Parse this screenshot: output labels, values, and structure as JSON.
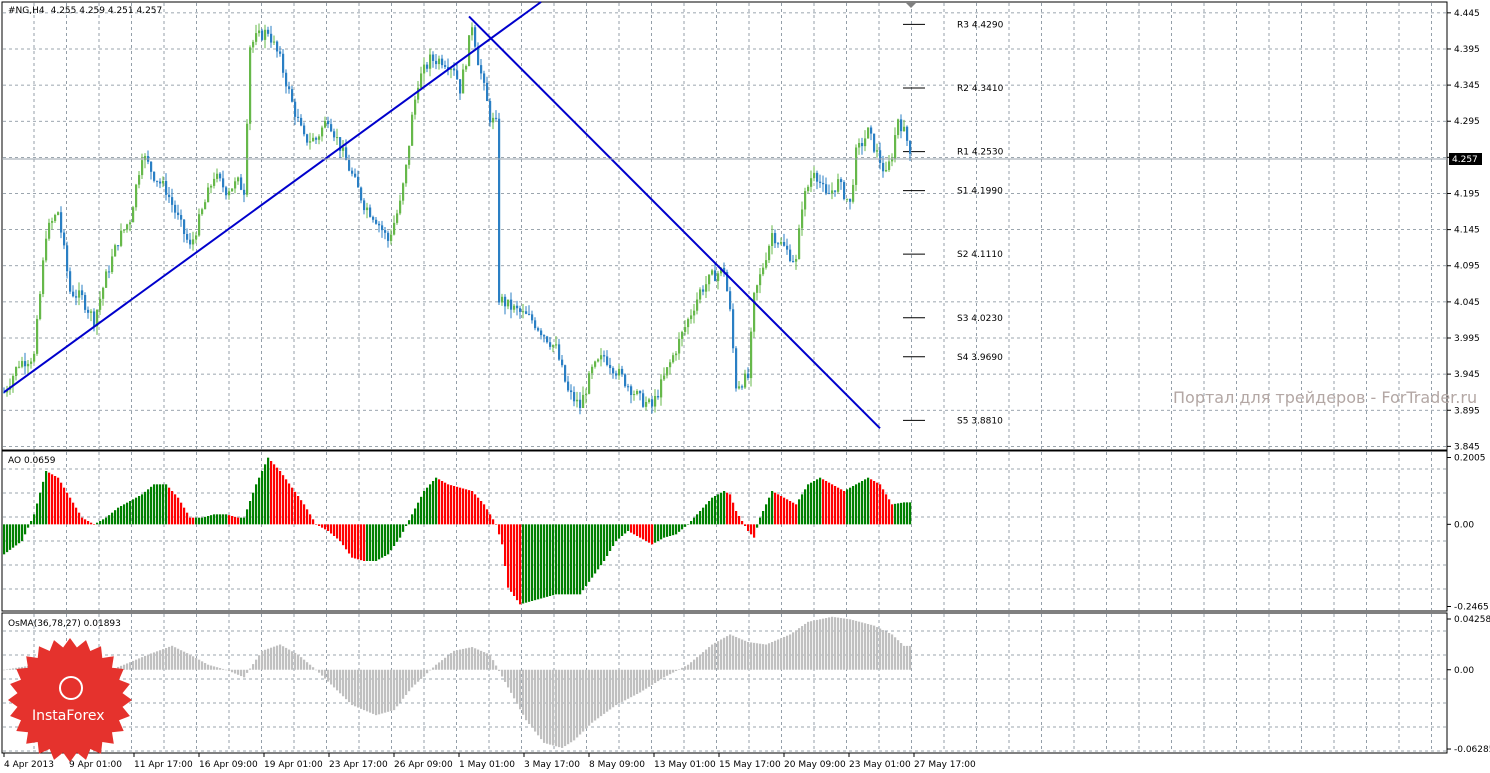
{
  "chart_data": [
    {
      "type": "candlestick",
      "title": "#NG,H4",
      "ohlc_header": "4.255 4.259 4.251 4.257",
      "current_price": "4.257",
      "y_ticks": [
        "4.445",
        "4.395",
        "4.345",
        "4.295",
        "4.245",
        "4.195",
        "4.145",
        "4.095",
        "4.045",
        "3.995",
        "3.945",
        "3.895",
        "3.845"
      ],
      "ylim": [
        3.84,
        4.46
      ],
      "x_ticks": [
        "4 Apr 2013",
        "9 Apr 01:00",
        "11 Apr 17:00",
        "16 Apr 09:00",
        "19 Apr 01:00",
        "23 Apr 17:00",
        "26 Apr 09:00",
        "1 May 01:00",
        "3 May 17:00",
        "8 May 09:00",
        "13 May 01:00",
        "15 May 17:00",
        "20 May 09:00",
        "23 May 01:00",
        "27 May 17:00"
      ],
      "pivot_levels": [
        {
          "label": "R3",
          "value": "4.4290"
        },
        {
          "label": "R2",
          "value": "4.3410"
        },
        {
          "label": "R1",
          "value": "4.2530"
        },
        {
          "label": "S1",
          "value": "4.1990"
        },
        {
          "label": "S2",
          "value": "4.1110"
        },
        {
          "label": "S3",
          "value": "4.0230"
        },
        {
          "label": "S4",
          "value": "3.9690"
        },
        {
          "label": "S5",
          "value": "3.8810"
        }
      ],
      "trendlines": [
        {
          "name": "support-trendline",
          "from": [
            0,
            3.92
          ],
          "to": [
            179,
            4.46
          ]
        },
        {
          "name": "resistance-trendline",
          "from": [
            155,
            4.44
          ],
          "to": [
            292,
            3.87
          ]
        }
      ],
      "close_path": [
        [
          0,
          3.92
        ],
        [
          5,
          3.96
        ],
        [
          10,
          3.97
        ],
        [
          14,
          4.14
        ],
        [
          18,
          4.17
        ],
        [
          22,
          4.06
        ],
        [
          26,
          4.05
        ],
        [
          30,
          4.02
        ],
        [
          34,
          4.08
        ],
        [
          38,
          4.13
        ],
        [
          42,
          4.16
        ],
        [
          46,
          4.25
        ],
        [
          50,
          4.22
        ],
        [
          54,
          4.2
        ],
        [
          58,
          4.16
        ],
        [
          62,
          4.12
        ],
        [
          66,
          4.17
        ],
        [
          70,
          4.22
        ],
        [
          74,
          4.2
        ],
        [
          78,
          4.21
        ],
        [
          80,
          4.2
        ],
        [
          82,
          4.4
        ],
        [
          84,
          4.41
        ],
        [
          88,
          4.42
        ],
        [
          92,
          4.38
        ],
        [
          96,
          4.32
        ],
        [
          100,
          4.27
        ],
        [
          104,
          4.27
        ],
        [
          108,
          4.3
        ],
        [
          112,
          4.26
        ],
        [
          116,
          4.22
        ],
        [
          120,
          4.18
        ],
        [
          124,
          4.16
        ],
        [
          128,
          4.13
        ],
        [
          132,
          4.18
        ],
        [
          134,
          4.23
        ],
        [
          136,
          4.3
        ],
        [
          138,
          4.35
        ],
        [
          142,
          4.38
        ],
        [
          146,
          4.38
        ],
        [
          150,
          4.37
        ],
        [
          152,
          4.34
        ],
        [
          154,
          4.38
        ],
        [
          156,
          4.43
        ],
        [
          158,
          4.38
        ],
        [
          160,
          4.34
        ],
        [
          162,
          4.3
        ],
        [
          164,
          4.29
        ],
        [
          165,
          4.05
        ],
        [
          168,
          4.04
        ],
        [
          172,
          4.03
        ],
        [
          176,
          4.02
        ],
        [
          180,
          4.0
        ],
        [
          184,
          3.98
        ],
        [
          188,
          3.92
        ],
        [
          192,
          3.9
        ],
        [
          196,
          3.95
        ],
        [
          200,
          3.97
        ],
        [
          204,
          3.95
        ],
        [
          208,
          3.93
        ],
        [
          212,
          3.91
        ],
        [
          216,
          3.9
        ],
        [
          220,
          3.94
        ],
        [
          224,
          3.98
        ],
        [
          228,
          4.02
        ],
        [
          232,
          4.06
        ],
        [
          236,
          4.08
        ],
        [
          240,
          4.09
        ],
        [
          242,
          4.03
        ],
        [
          244,
          3.93
        ],
        [
          248,
          3.94
        ],
        [
          250,
          4.05
        ],
        [
          252,
          4.08
        ],
        [
          256,
          4.14
        ],
        [
          260,
          4.12
        ],
        [
          264,
          4.1
        ],
        [
          266,
          4.18
        ],
        [
          270,
          4.23
        ],
        [
          274,
          4.19
        ],
        [
          278,
          4.21
        ],
        [
          282,
          4.18
        ],
        [
          284,
          4.25
        ],
        [
          288,
          4.28
        ],
        [
          290,
          4.26
        ],
        [
          292,
          4.24
        ],
        [
          294,
          4.22
        ],
        [
          296,
          4.25
        ],
        [
          298,
          4.3
        ],
        [
          300,
          4.28
        ],
        [
          302,
          4.257
        ]
      ]
    },
    {
      "type": "bar",
      "title": "AO 0.0659",
      "y_ticks": [
        "0.2005",
        "0.00",
        "-0.2465"
      ],
      "ylim": [
        -0.26,
        0.22
      ],
      "color_up": "#008000",
      "color_down": "#ff0000",
      "envelope": [
        [
          0,
          -0.09
        ],
        [
          6,
          -0.05
        ],
        [
          10,
          0.03
        ],
        [
          14,
          0.16
        ],
        [
          18,
          0.14
        ],
        [
          22,
          0.08
        ],
        [
          26,
          0.02
        ],
        [
          30,
          0.0
        ],
        [
          34,
          0.02
        ],
        [
          38,
          0.05
        ],
        [
          42,
          0.07
        ],
        [
          46,
          0.09
        ],
        [
          50,
          0.12
        ],
        [
          54,
          0.12
        ],
        [
          58,
          0.08
        ],
        [
          62,
          0.02
        ],
        [
          66,
          0.02
        ],
        [
          70,
          0.03
        ],
        [
          74,
          0.03
        ],
        [
          78,
          0.02
        ],
        [
          80,
          0.02
        ],
        [
          84,
          0.12
        ],
        [
          88,
          0.2
        ],
        [
          92,
          0.16
        ],
        [
          96,
          0.11
        ],
        [
          100,
          0.06
        ],
        [
          104,
          0.0
        ],
        [
          108,
          -0.02
        ],
        [
          112,
          -0.05
        ],
        [
          116,
          -0.1
        ],
        [
          120,
          -0.11
        ],
        [
          124,
          -0.11
        ],
        [
          128,
          -0.09
        ],
        [
          132,
          -0.04
        ],
        [
          136,
          0.03
        ],
        [
          140,
          0.1
        ],
        [
          144,
          0.14
        ],
        [
          148,
          0.12
        ],
        [
          152,
          0.11
        ],
        [
          156,
          0.1
        ],
        [
          160,
          0.06
        ],
        [
          164,
          0.0
        ],
        [
          166,
          -0.06
        ],
        [
          168,
          -0.19
        ],
        [
          172,
          -0.24
        ],
        [
          176,
          -0.23
        ],
        [
          180,
          -0.22
        ],
        [
          184,
          -0.21
        ],
        [
          188,
          -0.21
        ],
        [
          192,
          -0.21
        ],
        [
          196,
          -0.16
        ],
        [
          200,
          -0.11
        ],
        [
          204,
          -0.05
        ],
        [
          208,
          -0.02
        ],
        [
          212,
          -0.04
        ],
        [
          216,
          -0.06
        ],
        [
          220,
          -0.04
        ],
        [
          224,
          -0.03
        ],
        [
          228,
          0.0
        ],
        [
          232,
          0.04
        ],
        [
          236,
          0.08
        ],
        [
          240,
          0.1
        ],
        [
          242,
          0.09
        ],
        [
          244,
          0.04
        ],
        [
          248,
          -0.02
        ],
        [
          250,
          -0.04
        ],
        [
          252,
          0.02
        ],
        [
          256,
          0.1
        ],
        [
          260,
          0.08
        ],
        [
          264,
          0.06
        ],
        [
          268,
          0.12
        ],
        [
          272,
          0.14
        ],
        [
          276,
          0.12
        ],
        [
          280,
          0.1
        ],
        [
          284,
          0.12
        ],
        [
          288,
          0.14
        ],
        [
          292,
          0.12
        ],
        [
          296,
          0.06
        ],
        [
          300,
          0.0659
        ]
      ]
    },
    {
      "type": "bar",
      "title": "OsMA(36,78,27) 0.01893",
      "y_ticks": [
        "0.04258",
        "0.00",
        "-0.06285"
      ],
      "ylim": [
        -0.066,
        0.045
      ],
      "color": "#c0c0c0",
      "envelope": [
        [
          0,
          0.0
        ],
        [
          8,
          0.003
        ],
        [
          16,
          0.006
        ],
        [
          24,
          0.0
        ],
        [
          32,
          -0.003
        ],
        [
          40,
          0.004
        ],
        [
          48,
          0.012
        ],
        [
          56,
          0.019
        ],
        [
          62,
          0.012
        ],
        [
          68,
          0.004
        ],
        [
          74,
          0.0
        ],
        [
          80,
          -0.006
        ],
        [
          86,
          0.015
        ],
        [
          92,
          0.02
        ],
        [
          98,
          0.012
        ],
        [
          104,
          0.0
        ],
        [
          110,
          -0.014
        ],
        [
          116,
          -0.028
        ],
        [
          124,
          -0.036
        ],
        [
          130,
          -0.032
        ],
        [
          136,
          -0.014
        ],
        [
          144,
          0.004
        ],
        [
          150,
          0.015
        ],
        [
          156,
          0.018
        ],
        [
          162,
          0.012
        ],
        [
          168,
          -0.014
        ],
        [
          174,
          -0.04
        ],
        [
          180,
          -0.058
        ],
        [
          186,
          -0.062
        ],
        [
          190,
          -0.056
        ],
        [
          196,
          -0.042
        ],
        [
          204,
          -0.028
        ],
        [
          212,
          -0.018
        ],
        [
          220,
          -0.006
        ],
        [
          228,
          0.004
        ],
        [
          236,
          0.02
        ],
        [
          242,
          0.028
        ],
        [
          248,
          0.022
        ],
        [
          254,
          0.02
        ],
        [
          262,
          0.028
        ],
        [
          268,
          0.038
        ],
        [
          276,
          0.042
        ],
        [
          282,
          0.04
        ],
        [
          290,
          0.035
        ],
        [
          296,
          0.028
        ],
        [
          300,
          0.01893
        ]
      ]
    }
  ],
  "watermark": "Портал для трейдеров - ForTrader.ru",
  "badge": {
    "text": "InstaForex",
    "color": "#e5322d"
  }
}
